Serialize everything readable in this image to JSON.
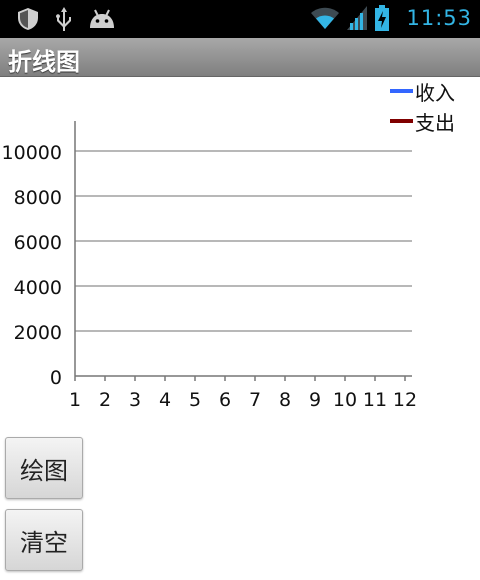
{
  "status_bar": {
    "time": "11:53",
    "icons": [
      "shield-icon",
      "usb-icon",
      "android-icon",
      "wifi-icon",
      "signal-icon",
      "battery-charging-icon"
    ],
    "accent_color": "#33b5e5"
  },
  "app": {
    "title": "折线图"
  },
  "chart_data": {
    "type": "line",
    "x": [
      1,
      2,
      3,
      4,
      5,
      6,
      7,
      8,
      9,
      10,
      11,
      12
    ],
    "x_tick_labels": [
      "1",
      "2",
      "3",
      "4",
      "5",
      "6",
      "7",
      "8",
      "9",
      "10",
      "11",
      "12"
    ],
    "y_tick_labels": [
      "0",
      "2000",
      "4000",
      "6000",
      "8000",
      "10000"
    ],
    "ylim": [
      0,
      10000
    ],
    "grid": true,
    "legend_position": "top-right",
    "series": [
      {
        "name": "收入",
        "color": "#3366ff",
        "values": []
      },
      {
        "name": "支出",
        "color": "#800000",
        "values": []
      }
    ]
  },
  "buttons": {
    "draw_label": "绘图",
    "clear_label": "清空"
  }
}
